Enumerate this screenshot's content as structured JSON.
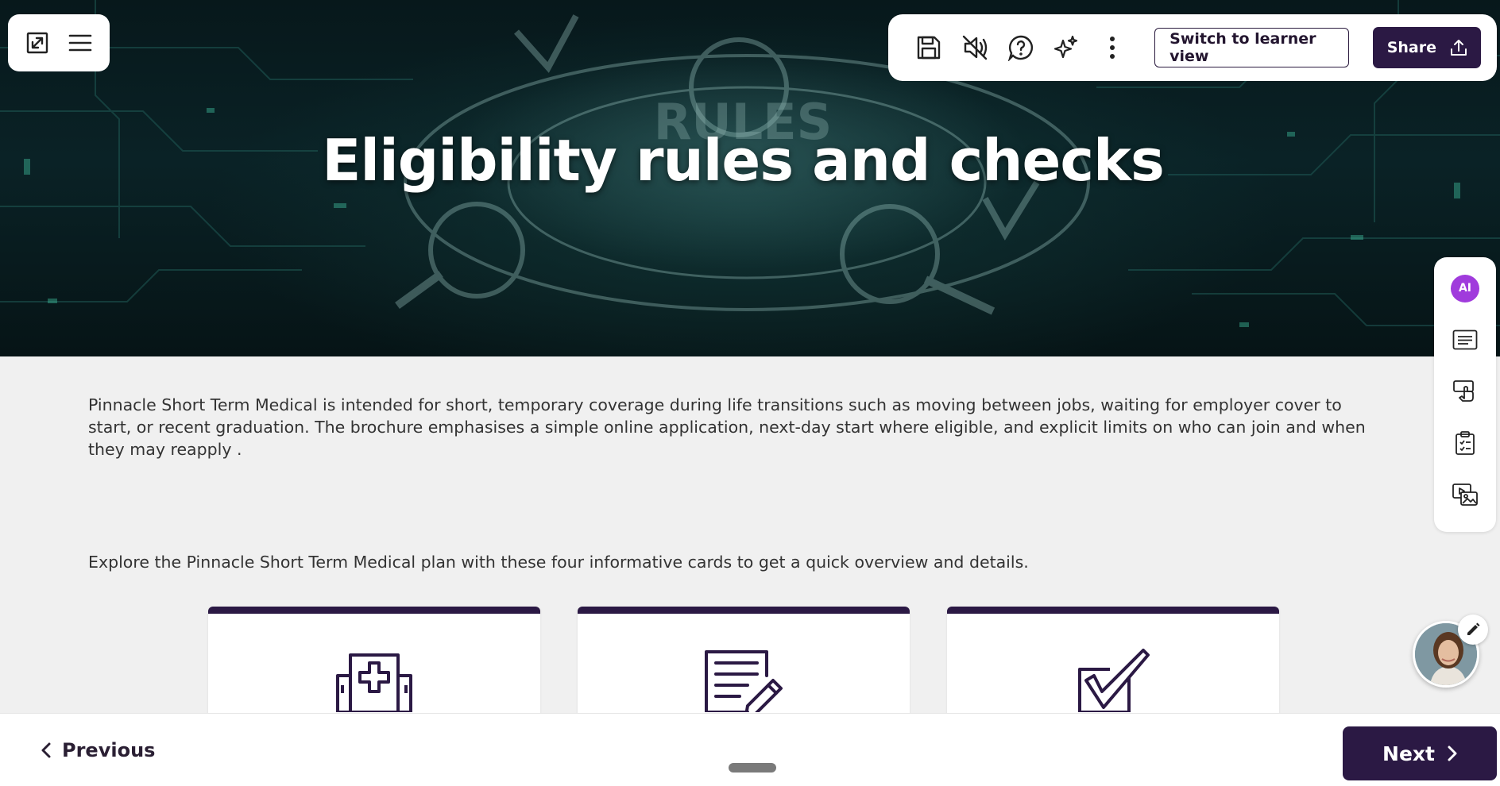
{
  "hero": {
    "title": "Eligibility rules and checks",
    "background_text": "RULES"
  },
  "top_left_panel": {
    "icons": [
      "expand-icon",
      "menu-icon"
    ]
  },
  "toolbar": {
    "icons": [
      "save-icon",
      "mute-icon",
      "help-icon",
      "sparkle-icon",
      "more-icon"
    ],
    "switch_view_label": "Switch to learner view",
    "share_label": "Share"
  },
  "rail": {
    "ai_label": "AI",
    "icons": [
      "text-block-icon",
      "interactive-icon",
      "quiz-icon",
      "media-icon"
    ]
  },
  "content": {
    "intro": "Pinnacle Short Term Medical is intended for short, temporary coverage during life transitions such as moving between jobs, waiting for employer cover to start, or recent graduation. The brochure emphasises a simple online application, next-day start where eligible, and explicit limits on who can join and when they may reapply .",
    "explore": "Explore the Pinnacle Short Term Medical plan with these four informative cards to get a quick overview and details.",
    "cards": [
      {
        "icon": "hospital-icon"
      },
      {
        "icon": "document-edit-icon"
      },
      {
        "icon": "checkbox-icon"
      }
    ]
  },
  "navigation": {
    "previous_label": "Previous",
    "next_label": "Next"
  },
  "colors": {
    "brand_dark": "#2b1944",
    "ai_badge": "#a03bdc",
    "page_bg": "#f0f0f0"
  }
}
